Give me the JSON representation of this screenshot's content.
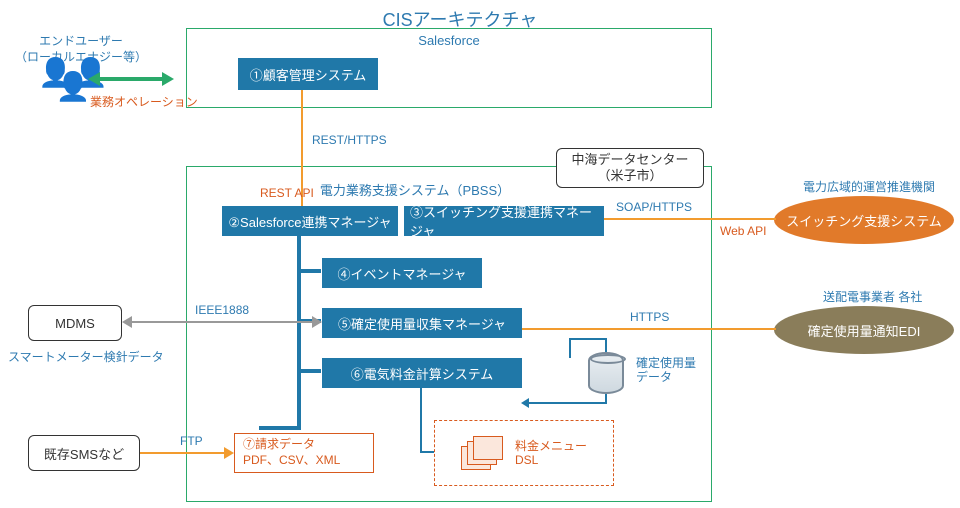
{
  "title": "CISアーキテクチャ",
  "end_user": {
    "line1": "エンドユーザー",
    "line2": "（ローカルエナジー等）",
    "ops": "業務オペレーション"
  },
  "salesforce": {
    "label": "Salesforce",
    "cms": "①顧客管理システム"
  },
  "protocols": {
    "rest_https": "REST/HTTPS",
    "rest_api": "REST API",
    "soap_https": "SOAP/HTTPS",
    "web_api": "Web API",
    "https": "HTTPS",
    "ieee1888": "IEEE1888",
    "ftp": "FTP"
  },
  "datacenter": {
    "line1": "中海データセンター",
    "line2": "（米子市）"
  },
  "pbss": {
    "label": "電力業務支援システム（PBSS）",
    "sf_mgr": "②Salesforce連携マネージャ",
    "sw_mgr": "③スイッチング支援連携マネージャ",
    "ev_mgr": "④イベントマネージャ",
    "usage_mgr": "⑤確定使用量収集マネージャ",
    "billing": "⑥電気料金計算システム",
    "invoice1": "⑦請求データ",
    "invoice2": "PDF、CSV、XML",
    "menu1": "料金メニュー",
    "menu2": "DSL",
    "db1": "確定使用量",
    "db2": "データ"
  },
  "mdms": {
    "name": "MDMS",
    "note": "スマートメーター検針データ"
  },
  "sms": "既存SMSなど",
  "right": {
    "switching_org": "電力広域的運営推進機関",
    "switching_sys": "スイッチング支援システム",
    "td_org": "送配電事業者 各社",
    "edi": "確定使用量通知EDI"
  }
}
